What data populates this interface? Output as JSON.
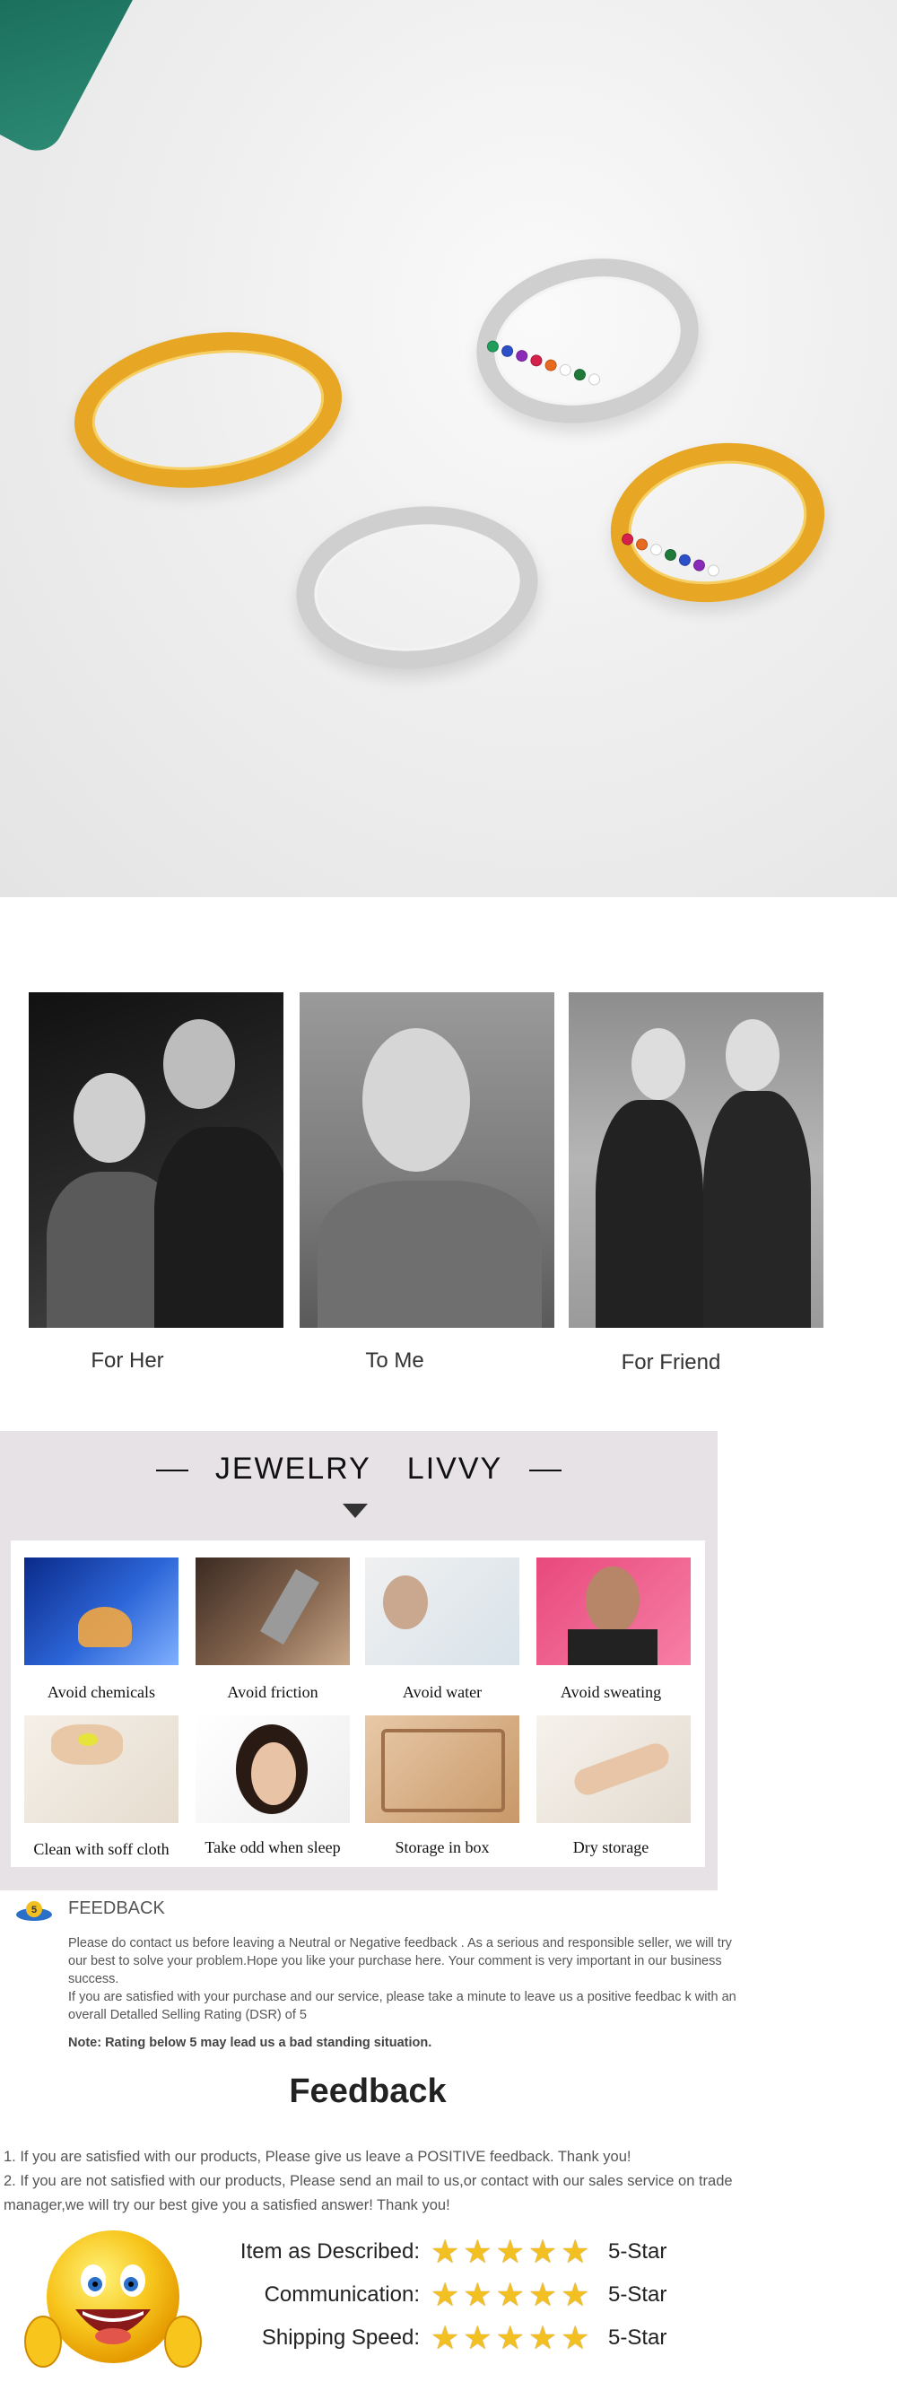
{
  "occasions": [
    {
      "label": "For Her"
    },
    {
      "label": "To Me"
    },
    {
      "label": "For Friend"
    }
  ],
  "care": {
    "brand_left": "JEWELRY",
    "brand_right": "LIVVY",
    "tips": [
      {
        "label": "Avoid chemicals",
        "icon": "lab-flask-icon"
      },
      {
        "label": "Avoid friction",
        "icon": "grinder-icon"
      },
      {
        "label": "Avoid water",
        "icon": "water-splash-icon"
      },
      {
        "label": "Avoid sweating",
        "icon": "sweat-icon"
      },
      {
        "label": "Clean with soff cloth",
        "icon": "cloth-icon"
      },
      {
        "label": "Take odd when sleep",
        "icon": "sleep-icon"
      },
      {
        "label": "Storage in box",
        "icon": "jewelry-box-icon"
      },
      {
        "label": "Dry storage",
        "icon": "dry-hand-icon"
      }
    ]
  },
  "feedback": {
    "logo_text": "5",
    "title": "FEEDBACK",
    "para1": "Please do contact us before leaving a Neutral or Negative  feedback . As a serious and responsible seller, we will try our best to solve your problem.Hope you like your purchase here. Your comment is very important in our business success.",
    "para2": " If you are satisfied with your purchase and our service,  please take a minute to leave us  a positive feedbac k with an overall  Detalled Selling Rating (DSR) of 5",
    "note": "Note: Rating below 5 may lead us a bad standing situation.",
    "heading": "Feedback",
    "line1": "1. If you are satisfied with our products, Please give us leave a POSITIVE feedback. Thank you!",
    "line2": "2. If you are not satisfied with our products, Please send an mail to us,or contact with our sales service on trade manager,we will try our best give you a satisfied answer! Thank you!",
    "ratings": [
      {
        "label": "Item as Described:",
        "stars": 5,
        "value": "5-Star"
      },
      {
        "label": "Communication:",
        "stars": 5,
        "value": "5-Star"
      },
      {
        "label": "Shipping Speed:",
        "stars": 5,
        "value": "5-Star"
      }
    ]
  },
  "colors": {
    "gold": "#e7a623",
    "silver": "#cfcfcf",
    "star": "#f3c021",
    "panel": "#e6e2e6"
  }
}
